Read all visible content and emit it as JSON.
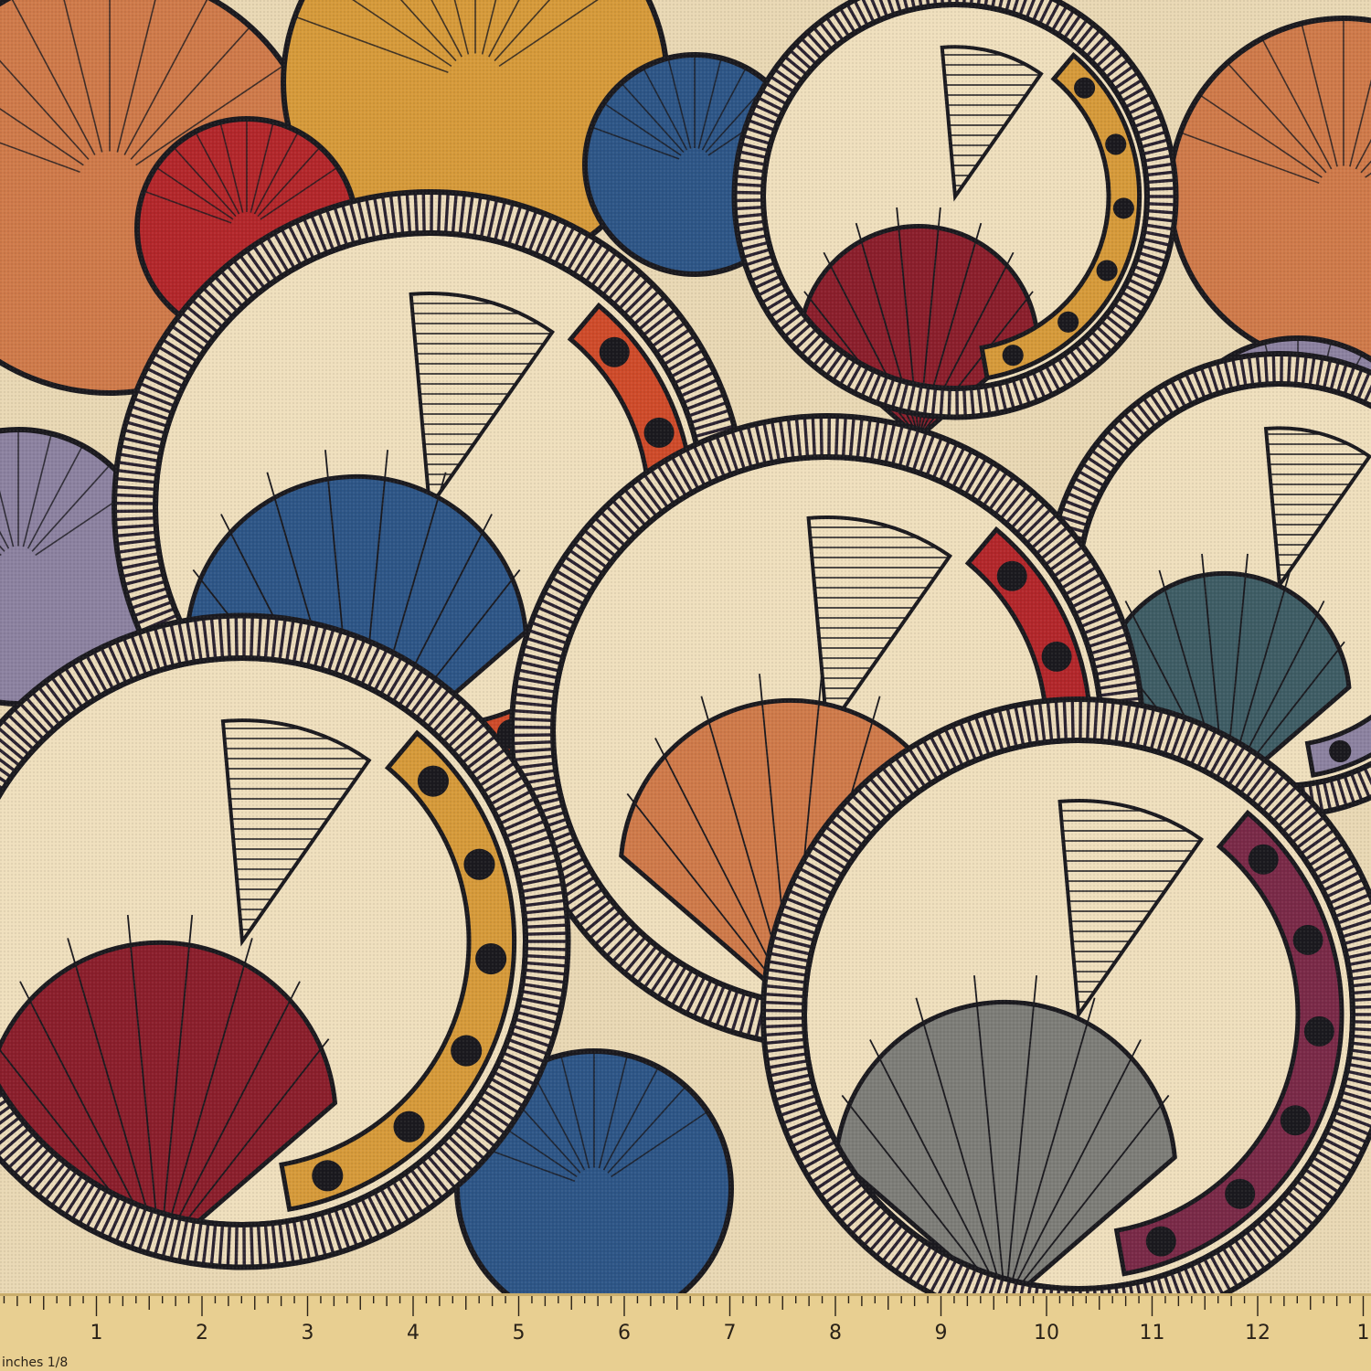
{
  "fabric": {
    "colors": {
      "outline": "#1b1a1f",
      "cream": "#efdfbd",
      "red": "#b3272b",
      "terracotta": "#cf4b2a",
      "orange": "#cf7a4a",
      "mustard": "#d69a3a",
      "blue": "#2e5687",
      "purple": "#8c82a0",
      "maroon": "#8b1f2c",
      "teal": "#3f5d65",
      "gray": "#7d7d78",
      "plum": "#7a2a48",
      "stripe_light": "#ecdcbb",
      "stripe_dark": "#2a2230"
    },
    "motif": "fan-shells-with-striped-rings-and-dotted-crescents"
  },
  "ruler": {
    "unit_label": "inches 1/8",
    "numbers": [
      "1",
      "2",
      "3",
      "4",
      "5",
      "6",
      "7",
      "8",
      "9",
      "10",
      "11",
      "12",
      "1"
    ],
    "colors": {
      "wood": "#e8cf91",
      "ink": "#2a2218"
    }
  }
}
